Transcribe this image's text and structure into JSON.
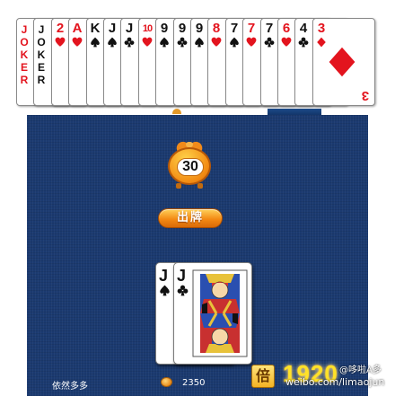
{
  "hand": [
    {
      "type": "joker",
      "text": "JOKER",
      "color": "red"
    },
    {
      "type": "joker",
      "text": "JOKER",
      "color": "black"
    },
    {
      "type": "card",
      "rank": "2",
      "suit": "heart"
    },
    {
      "type": "card",
      "rank": "A",
      "suit": "heart"
    },
    {
      "type": "card",
      "rank": "K",
      "suit": "spade"
    },
    {
      "type": "card",
      "rank": "J",
      "suit": "spade"
    },
    {
      "type": "card",
      "rank": "J",
      "suit": "club"
    },
    {
      "type": "card",
      "rank": "10",
      "suit": "heart"
    },
    {
      "type": "card",
      "rank": "9",
      "suit": "spade"
    },
    {
      "type": "card",
      "rank": "9",
      "suit": "club"
    },
    {
      "type": "card",
      "rank": "9",
      "suit": "spade"
    },
    {
      "type": "card",
      "rank": "8",
      "suit": "heart"
    },
    {
      "type": "card",
      "rank": "7",
      "suit": "spade"
    },
    {
      "type": "card",
      "rank": "7",
      "suit": "heart"
    },
    {
      "type": "card",
      "rank": "7",
      "suit": "club"
    },
    {
      "type": "card",
      "rank": "6",
      "suit": "heart"
    },
    {
      "type": "card",
      "rank": "4",
      "suit": "club"
    },
    {
      "type": "card",
      "rank": "3",
      "suit": "diamond",
      "face": "big"
    }
  ],
  "timer": {
    "value": "30"
  },
  "play_button": {
    "label": "出牌"
  },
  "played_cards": [
    {
      "rank": "J",
      "suit": "spade"
    },
    {
      "rank": "J",
      "suit": "club"
    }
  ],
  "player": {
    "name": "依然多多",
    "coins": "2350"
  },
  "multiplier": {
    "icon_label": "倍",
    "value": "1920"
  },
  "watermark": {
    "line1": "@哆啦A多",
    "line2": "weibo.com/limaojun"
  },
  "colors": {
    "table": "#1b3a70",
    "red_suit": "#e3141e",
    "black_suit": "#111111",
    "accent_orange": "#f28a12",
    "multiplier_yellow": "#ffe227"
  }
}
